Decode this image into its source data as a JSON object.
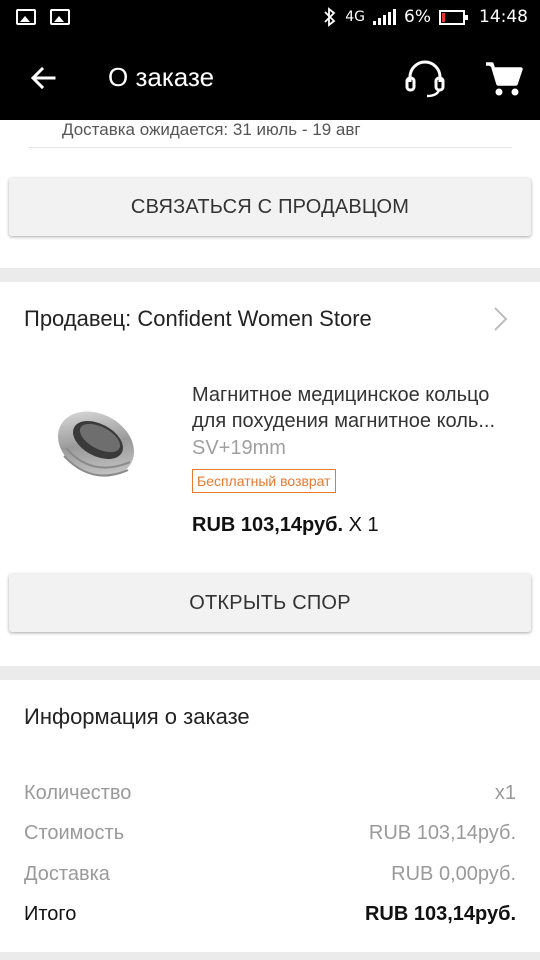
{
  "status_bar": {
    "battery": "6%",
    "time": "14:48",
    "network": "4G"
  },
  "app_bar": {
    "title": "О заказе"
  },
  "delivery": {
    "text": "Доставка ожидается: 31 июль - 19 авг"
  },
  "buttons": {
    "contact_seller": "СВЯЗАТЬСЯ С ПРОДАВЦОМ",
    "open_dispute": "ОТКРЫТЬ СПОР"
  },
  "seller": {
    "label": "Продавец: Confident Women Store"
  },
  "product": {
    "name_line1": "Магнитное медицинское кольцо",
    "name_line2": "для похудения магнитное коль...",
    "variant": "SV+19mm",
    "badge": "Бесплатный возврат",
    "price": "RUB 103,14руб.",
    "quantity": "X 1"
  },
  "order_info": {
    "title": "Информация о заказе",
    "rows": [
      {
        "label": "Количество",
        "value": "x1"
      },
      {
        "label": "Стоимость",
        "value": "RUB 103,14руб."
      },
      {
        "label": "Доставка",
        "value": "RUB 0,00руб."
      },
      {
        "label": "Итого",
        "value": "RUB 103,14руб."
      }
    ]
  },
  "colors": {
    "accent_orange": "#e8792e",
    "app_bar": "#000000",
    "button_bg": "#f2f2f2"
  },
  "icons": [
    "image-icon",
    "bluetooth-icon",
    "signal-icon",
    "battery-icon",
    "back-arrow-icon",
    "headset-support-icon",
    "shopping-cart-icon",
    "chevron-right-icon"
  ]
}
